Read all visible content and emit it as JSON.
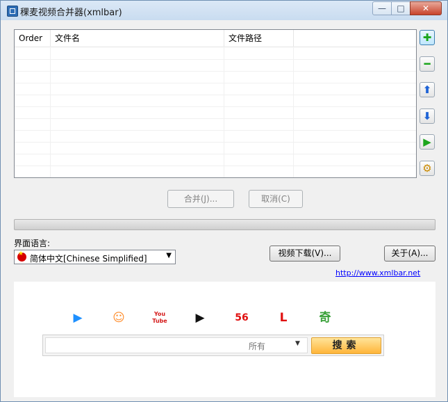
{
  "window": {
    "title": "稞麦视频合并器(xmlbar)"
  },
  "controls": {
    "min": "—",
    "max": "□",
    "close": "✕"
  },
  "table": {
    "columns": [
      "Order",
      "文件名",
      "文件路径"
    ],
    "rows": []
  },
  "side_buttons": [
    {
      "name": "add-icon",
      "glyph": "✚",
      "color": "#1ca51c"
    },
    {
      "name": "remove-icon",
      "glyph": "━",
      "color": "#1ca51c"
    },
    {
      "name": "move-up-icon",
      "glyph": "⬆",
      "color": "#1e63d6"
    },
    {
      "name": "move-down-icon",
      "glyph": "⬇",
      "color": "#1e63d6"
    },
    {
      "name": "play-icon",
      "glyph": "▶",
      "color": "#1ca51c"
    },
    {
      "name": "settings-icon",
      "glyph": "⚙",
      "color": "#c98a00"
    }
  ],
  "actions": {
    "merge": "合并(J)...",
    "cancel": "取消(C)"
  },
  "language": {
    "label": "界面语言:",
    "selected": "简体中文[Chinese Simplified]"
  },
  "buttons": {
    "video_download": "视频下载(V)...",
    "about": "关于(A)..."
  },
  "link": "http://www.xmlbar.net",
  "sites": [
    {
      "name": "site-icon-1",
      "glyph": "▶",
      "color": "#1e90ff"
    },
    {
      "name": "site-icon-2",
      "glyph": "☺",
      "color": "#ff8c2a"
    },
    {
      "name": "youtube-icon",
      "glyph": "You Tube",
      "color": "#d41919"
    },
    {
      "name": "site-icon-4",
      "glyph": "▶",
      "color": "#111111"
    },
    {
      "name": "site-56-icon",
      "glyph": "56",
      "color": "#e01010"
    },
    {
      "name": "site-icon-6",
      "glyph": "L",
      "color": "#e01010"
    },
    {
      "name": "site-icon-7",
      "glyph": "奇",
      "color": "#3aa13a"
    }
  ],
  "search": {
    "category": "所有",
    "button": "搜索"
  }
}
